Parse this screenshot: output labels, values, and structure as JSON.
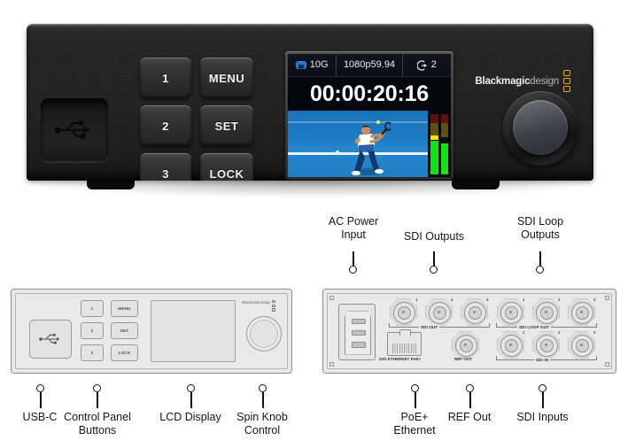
{
  "device": {
    "brand_bold": "Blackmagic",
    "brand_light": "design",
    "buttons": [
      {
        "label": "1",
        "name": "button-1"
      },
      {
        "label": "MENU",
        "name": "button-menu"
      },
      {
        "label": "2",
        "name": "button-2"
      },
      {
        "label": "SET",
        "name": "button-set"
      },
      {
        "label": "3",
        "name": "button-3"
      },
      {
        "label": "LOCK",
        "name": "button-lock"
      }
    ],
    "usb_icon": "usb-icon",
    "knob_icon": "spin-knob"
  },
  "lcd": {
    "status": {
      "network_icon": "ethernet-icon",
      "network_speed": "10G",
      "video_format": "1080p59.94",
      "output_icon": "output-arrow-icon",
      "output_count": "2"
    },
    "timecode": "00:00:20:16",
    "meters": [
      {
        "name": "audio-meter-left",
        "green_pct": 56,
        "cap_pct": 62
      },
      {
        "name": "audio-meter-right",
        "green_pct": 52,
        "cap_pct": 0
      }
    ]
  },
  "callouts": {
    "top": [
      {
        "name": "callout-ac-power-input",
        "lines": [
          "AC Power",
          "Input"
        ]
      },
      {
        "name": "callout-sdi-outputs",
        "lines": [
          "SDI Outputs"
        ]
      },
      {
        "name": "callout-sdi-loop-outputs",
        "lines": [
          "SDI Loop",
          "Outputs"
        ]
      }
    ],
    "bottom_left": [
      {
        "name": "callout-usb-c",
        "lines": [
          "USB-C"
        ]
      },
      {
        "name": "callout-control-panel-buttons",
        "lines": [
          "Control Panel",
          "Buttons"
        ]
      },
      {
        "name": "callout-lcd-display",
        "lines": [
          "LCD Display"
        ]
      },
      {
        "name": "callout-spin-knob-control",
        "lines": [
          "Spin Knob",
          "Control"
        ]
      }
    ],
    "bottom_right": [
      {
        "name": "callout-poe-ethernet",
        "lines": [
          "PoE+",
          "Ethernet"
        ]
      },
      {
        "name": "callout-ref-out",
        "lines": [
          "REF Out"
        ]
      },
      {
        "name": "callout-sdi-inputs",
        "lines": [
          "SDI Inputs"
        ]
      }
    ]
  },
  "front_diagram": {
    "buttons": [
      "1",
      "MENU",
      "2",
      "SET",
      "3",
      "LOCK"
    ],
    "brand": "Blackmagicdesign"
  },
  "rear_diagram": {
    "power_label": "",
    "ethernet_label": "10G ETHERNET PoE+",
    "ref_label": "REF OUT",
    "groups": [
      {
        "name": "sdi-out-group",
        "label": "SDI OUT",
        "numbers": [
          "1",
          "2",
          "3"
        ]
      },
      {
        "name": "sdi-loop-out-group",
        "label": "SDI LOOP OUT",
        "numbers": [
          "1",
          "2",
          "3"
        ]
      },
      {
        "name": "sdi-in-group",
        "label": "SDI IN",
        "numbers": [
          "1",
          "2",
          "3"
        ]
      }
    ]
  }
}
